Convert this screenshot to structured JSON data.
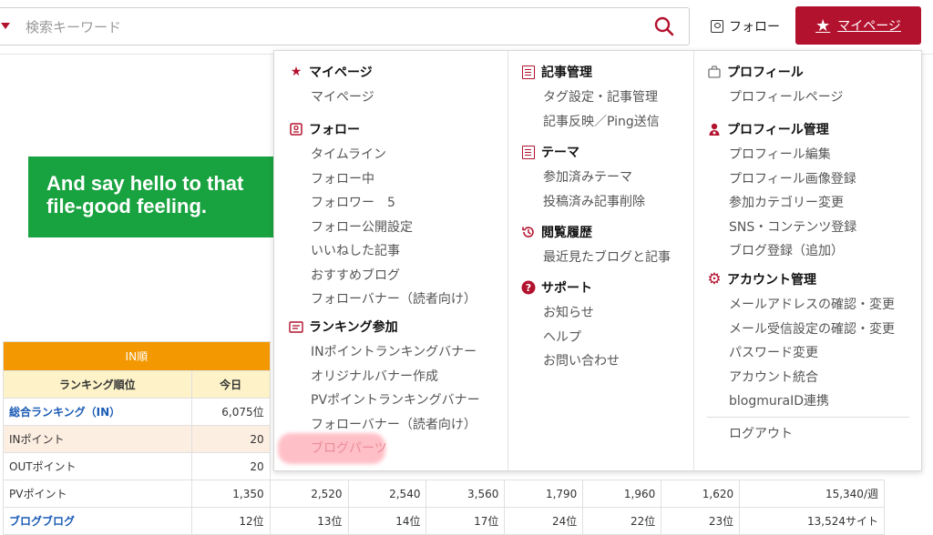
{
  "search": {
    "placeholder": "検索キーワード"
  },
  "header": {
    "follow_label": "フォロー",
    "mypage_label": "マイページ"
  },
  "ad": {
    "line1": "And say hello to that",
    "line2": "file-good feeling."
  },
  "ranking_table": {
    "section_header": "IN順",
    "columns": [
      "ランキング順位",
      "今日"
    ],
    "rows": [
      {
        "label": "総合ランキング（IN）",
        "values": [
          "6,075位"
        ]
      },
      {
        "label": "INポイント",
        "values": [
          "20"
        ]
      },
      {
        "label": "OUTポイント",
        "values": [
          "20"
        ]
      },
      {
        "label": "PVポイント",
        "values": [
          "1,350",
          "2,520",
          "2,540",
          "3,560",
          "1,790",
          "1,960",
          "1,620",
          "15,340/週"
        ]
      },
      {
        "label": "ブログブログ",
        "values": [
          "12位",
          "13位",
          "14位",
          "17位",
          "24位",
          "22位",
          "23位",
          "13,524サイト"
        ]
      }
    ]
  },
  "menu": {
    "col1": {
      "mypage": {
        "title": "マイページ",
        "items": [
          "マイページ"
        ]
      },
      "follow": {
        "title": "フォロー",
        "items": [
          "タイムライン",
          "フォロー中",
          "フォロワー　5",
          "フォロー公開設定",
          "いいねした記事",
          "おすすめブログ",
          "フォローバナー（読者向け）"
        ]
      },
      "ranking": {
        "title": "ランキング参加",
        "items": [
          "INポイントランキングバナー",
          "オリジナルバナー作成",
          "PVポイントランキングバナー",
          "フォローバナー（読者向け）",
          "ブログパーツ"
        ]
      }
    },
    "col2": {
      "articles": {
        "title": "記事管理",
        "items": [
          "タグ設定・記事管理",
          "記事反映／Ping送信"
        ]
      },
      "theme": {
        "title": "テーマ",
        "items": [
          "参加済みテーマ",
          "投稿済み記事削除"
        ]
      },
      "history": {
        "title": "閲覧履歴",
        "items": [
          "最近見たブログと記事"
        ]
      },
      "support": {
        "title": "サポート",
        "items": [
          "お知らせ",
          "ヘルプ",
          "お問い合わせ"
        ]
      }
    },
    "col3": {
      "profile": {
        "title": "プロフィール",
        "items": [
          "プロフィールページ"
        ]
      },
      "profile_admin": {
        "title": "プロフィール管理",
        "items": [
          "プロフィール編集",
          "プロフィール画像登録",
          "参加カテゴリー変更",
          "SNS・コンテンツ登録",
          "ブログ登録（追加）"
        ]
      },
      "account": {
        "title": "アカウント管理",
        "items": [
          "メールアドレスの確認・変更",
          "メール受信設定の確認・変更",
          "パスワード変更",
          "アカウント統合",
          "blogmuraID連携"
        ]
      },
      "logout": "ログアウト"
    }
  }
}
